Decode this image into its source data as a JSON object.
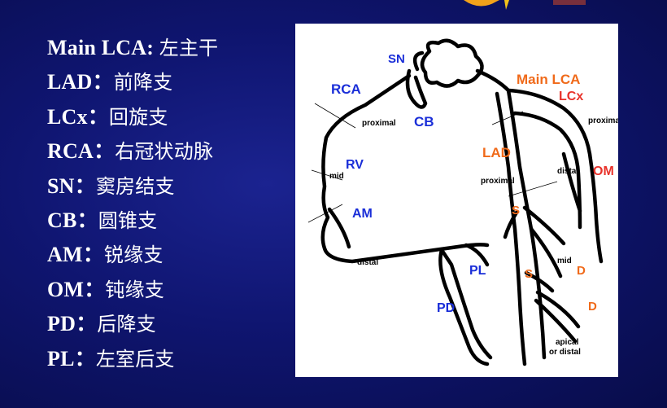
{
  "legend": [
    {
      "abbr": "Main LCA",
      "sep": ": ",
      "meaning": "左主干"
    },
    {
      "abbr": "LAD",
      "sep": "：",
      "meaning": "前降支"
    },
    {
      "abbr": "LCx",
      "sep": "：",
      "meaning": "回旋支"
    },
    {
      "abbr": "RCA",
      "sep": "：",
      "meaning": "右冠状动脉"
    },
    {
      "abbr": "SN",
      "sep": "：",
      "meaning": "窦房结支"
    },
    {
      "abbr": "CB",
      "sep": "：",
      "meaning": "圆锥支"
    },
    {
      "abbr": "AM",
      "sep": "：",
      "meaning": "锐缘支"
    },
    {
      "abbr": "OM",
      "sep": "：",
      "meaning": "钝缘支"
    },
    {
      "abbr": "PD",
      "sep": "：",
      "meaning": "后降支"
    },
    {
      "abbr": "PL",
      "sep": "：",
      "meaning": "左室后支"
    }
  ],
  "diagram": {
    "labels": {
      "sn": "SN",
      "rca": "RCA",
      "cb": "CB",
      "rv": "RV",
      "am": "AM",
      "pl": "PL",
      "pd": "PD",
      "main_lca": "Main LCA",
      "lcx": "LCx",
      "lad": "LAD",
      "om": "OM",
      "s1": "S",
      "s2": "S",
      "d1": "D",
      "d2": "D",
      "proximal_rca": "proximal",
      "mid_rca": "mid",
      "distal_rca": "distal",
      "proximal_lcx": "proximal",
      "distal_lcx": "distal",
      "proximal_lad": "proximal",
      "mid_lad": "mid",
      "apical_1": "apical",
      "apical_2": "or distal"
    },
    "colors": {
      "right_system": "#1a2ed8",
      "left_system": "#f06a1a",
      "om": "#e8322a",
      "background": "#0f1570",
      "legend_text": "#ffffff",
      "panel": "#ffffff"
    }
  }
}
